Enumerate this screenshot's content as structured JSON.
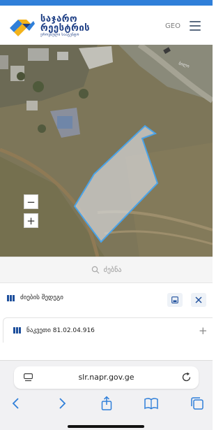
{
  "header": {
    "logo_line1": "საჯარო",
    "logo_line2": "რეესტრის",
    "logo_line3": "ეროვნული სააგენტო",
    "language": "GEO"
  },
  "map": {
    "road_label": "ბილი"
  },
  "zoom": {
    "zoom_in": "+",
    "zoom_out": "−"
  },
  "search": {
    "label": "ძებნა"
  },
  "results": {
    "title": "ძიების შედეგი"
  },
  "parcel": {
    "label": "ნაკვეთი 81.02.04.916"
  },
  "browser": {
    "url": "slr.napr.gov.ge"
  },
  "colors": {
    "accent": "#2f7fd9",
    "brand": "#1e3f85",
    "parcel_outline": "#4aa3e8"
  }
}
